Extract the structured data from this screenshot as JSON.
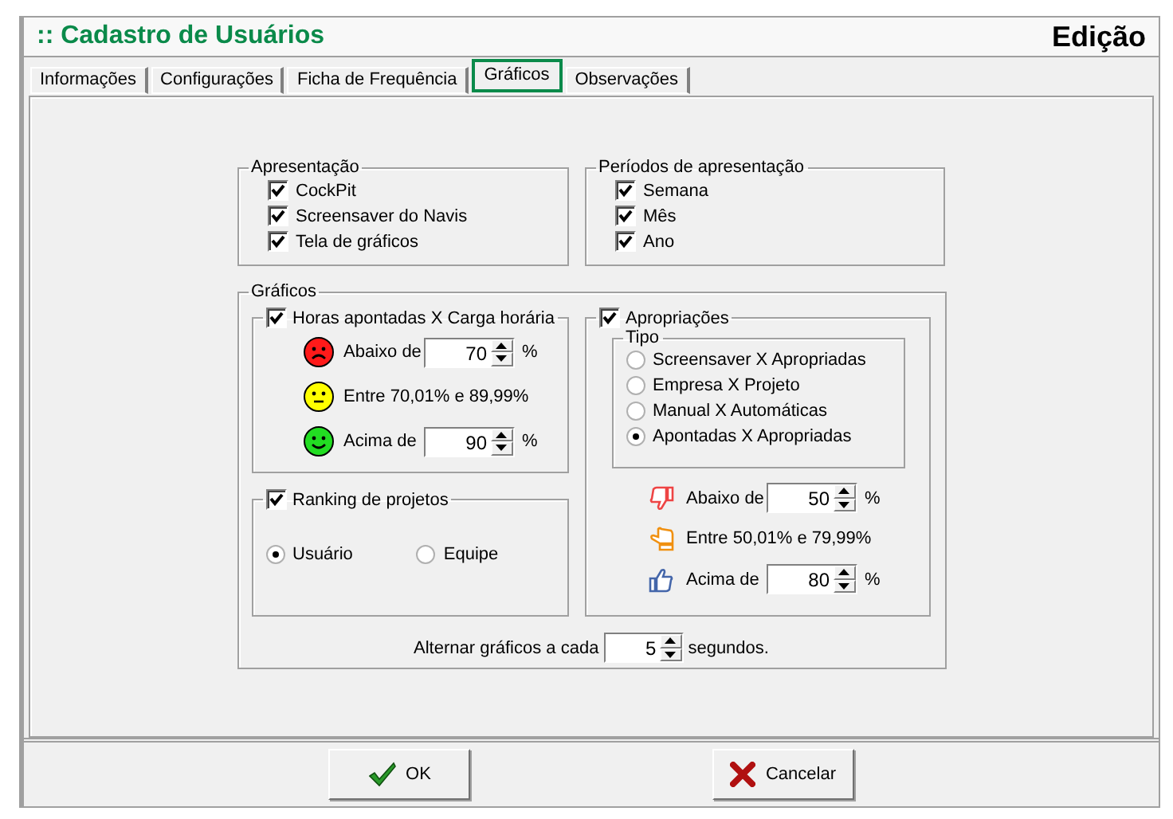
{
  "window": {
    "title": ":: Cadastro de Usuários",
    "mode": "Edição"
  },
  "tabs": [
    {
      "label": "Informações",
      "selected": false
    },
    {
      "label": "Configurações",
      "selected": false
    },
    {
      "label": "Ficha de Frequência",
      "selected": false
    },
    {
      "label": "Gráficos",
      "selected": true
    },
    {
      "label": "Observações",
      "selected": false
    }
  ],
  "apresentacao": {
    "title": "Apresentação",
    "options": [
      {
        "label": "CockPit",
        "checked": true
      },
      {
        "label": "Screensaver do Navis",
        "checked": true
      },
      {
        "label": "Tela de gráficos",
        "checked": true
      }
    ]
  },
  "periodos": {
    "title": "Períodos de apresentação",
    "options": [
      {
        "label": "Semana",
        "checked": true
      },
      {
        "label": "Mês",
        "checked": true
      },
      {
        "label": "Ano",
        "checked": true
      }
    ]
  },
  "graficos": {
    "title": "Gráficos",
    "horas": {
      "label": "Horas apontadas X Carga horária",
      "checked": true,
      "rows": [
        {
          "kind": "sad",
          "label": "Abaixo de",
          "value": "70",
          "unit": "%"
        },
        {
          "kind": "neutral",
          "label": "Entre 70,01% e 89,99%"
        },
        {
          "kind": "happy",
          "label": "Acima de",
          "value": "90",
          "unit": "%"
        }
      ]
    },
    "ranking": {
      "label": "Ranking de projetos",
      "checked": true,
      "options": [
        {
          "label": "Usuário",
          "selected": true
        },
        {
          "label": "Equipe",
          "selected": false
        }
      ]
    },
    "apropriacoes": {
      "label": "Apropriações",
      "checked": true,
      "tipo": {
        "title": "Tipo",
        "options": [
          {
            "label": "Screensaver X Apropriadas",
            "selected": false
          },
          {
            "label": "Empresa X Projeto",
            "selected": false
          },
          {
            "label": "Manual X Automáticas",
            "selected": false
          },
          {
            "label": "Apontadas X Apropriadas",
            "selected": true
          }
        ]
      },
      "rows": [
        {
          "kind": "down",
          "label": "Abaixo de",
          "value": "50",
          "unit": "%"
        },
        {
          "kind": "side",
          "label": "Entre 50,01% e 79,99%"
        },
        {
          "kind": "up",
          "label": "Acima de",
          "value": "80",
          "unit": "%"
        }
      ]
    },
    "alternar": {
      "label": "Alternar gráficos a cada",
      "value": "5",
      "unit": "segundos."
    }
  },
  "buttons": [
    {
      "kind": "ok",
      "label": "OK"
    },
    {
      "kind": "cancel",
      "label": "Cancelar"
    }
  ]
}
